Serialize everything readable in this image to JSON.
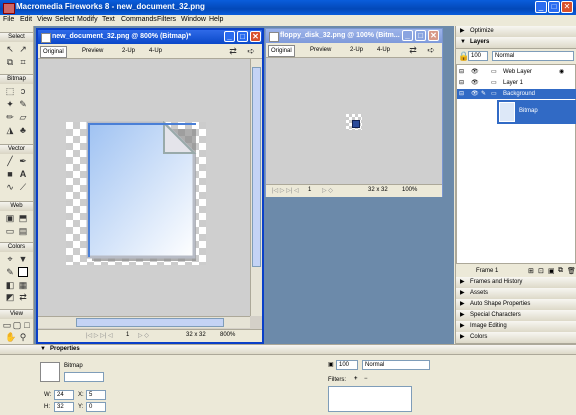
{
  "app": {
    "title": "Macromedia Fireworks 8 - new_document_32.png"
  },
  "menu": [
    "File",
    "Edit",
    "View",
    "Select",
    "Modify",
    "Text",
    "Commands",
    "Filters",
    "Window",
    "Help"
  ],
  "tools": {
    "sections": [
      "Select",
      "Bitmap",
      "Vector",
      "Web",
      "Colors",
      "View"
    ]
  },
  "doc1": {
    "title": "new_document_32.png @ 800% (Bitmap)*",
    "tabs": [
      "Original",
      "Preview",
      "2-Up",
      "4-Up"
    ],
    "status_page": "1",
    "status_size": "32 x 32",
    "status_zoom": "800%"
  },
  "doc2": {
    "title": "floppy_disk_32.png @ 100% (Bitm...",
    "tabs": [
      "Original",
      "Preview",
      "2-Up",
      "4-Up"
    ],
    "status_page": "1",
    "status_size": "32 x 32",
    "status_zoom": "100%"
  },
  "panels": {
    "optimize": "Optimize",
    "layers": {
      "title": "Layers",
      "opacity": "100",
      "blend": "Normal",
      "rows": [
        "Web Layer",
        "Layer 1",
        "Background",
        "Bitmap"
      ]
    },
    "frame_label": "Frame 1",
    "collapsed": [
      "Frames and History",
      "Assets",
      "Auto Shape Properties",
      "Special Characters",
      "Image Editing",
      "Colors"
    ]
  },
  "properties": {
    "title": "Properties",
    "object_type": "Bitmap",
    "name_value": "",
    "w_label": "W:",
    "w_value": "24",
    "h_label": "H:",
    "h_value": "32",
    "x_label": "X:",
    "x_value": "5",
    "y_label": "Y:",
    "y_value": "0",
    "opacity": "100",
    "blend": "Normal",
    "filters_label": "Filters:",
    "filters_add": "+",
    "filters_remove": "−"
  }
}
